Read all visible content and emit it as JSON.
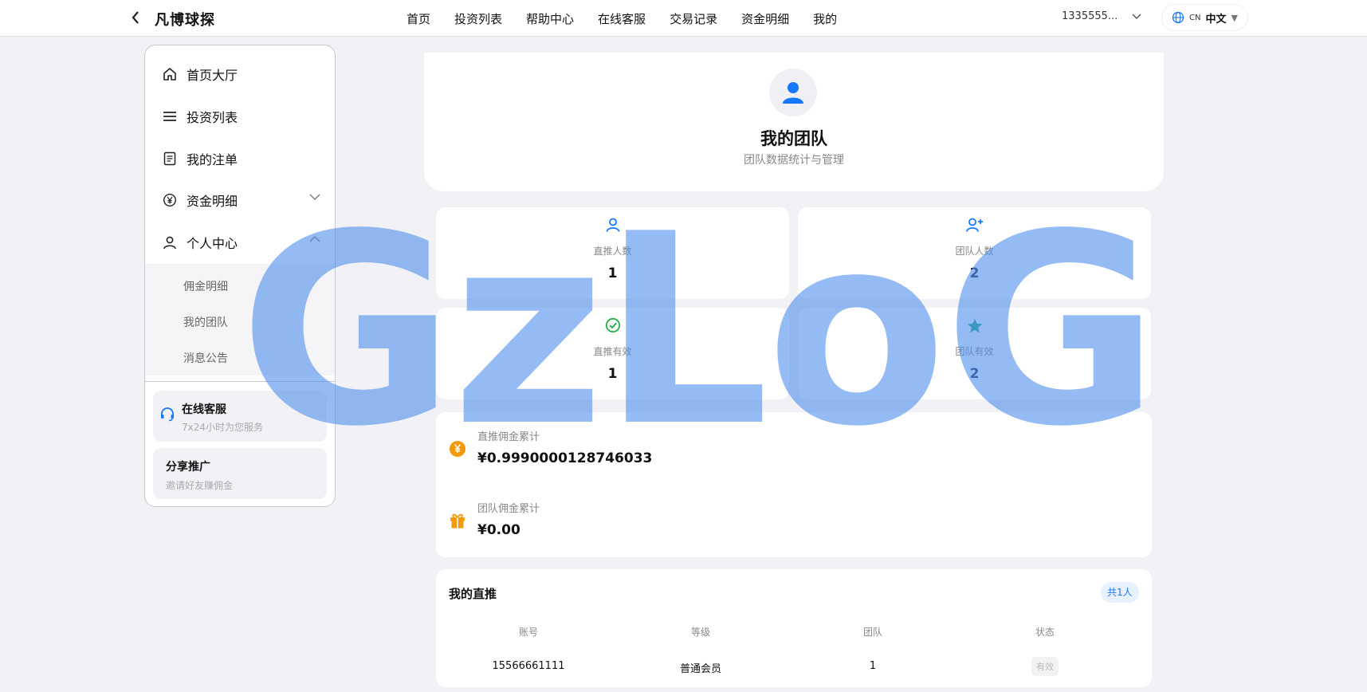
{
  "header": {
    "brand": "凡博球探",
    "nav": [
      "首页",
      "投资列表",
      "帮助中心",
      "在线客服",
      "交易记录",
      "资金明细",
      "我的"
    ],
    "account": "1335555...",
    "lang_code": "CN",
    "lang_label": "中文"
  },
  "sidebar": {
    "items": [
      {
        "label": "首页大厅"
      },
      {
        "label": "投资列表"
      },
      {
        "label": "我的注单"
      },
      {
        "label": "资金明细"
      },
      {
        "label": "个人中心"
      }
    ],
    "sub_items": [
      "佣金明细",
      "我的团队",
      "消息公告"
    ],
    "service": {
      "title": "在线客服",
      "subtitle": "7x24小时为您服务"
    },
    "share": {
      "title": "分享推广",
      "subtitle": "邀请好友赚佣金"
    }
  },
  "profile": {
    "title": "我的团队",
    "subtitle": "团队数据统计与管理"
  },
  "stats": [
    {
      "label": "直推人数",
      "value": "1"
    },
    {
      "label": "团队人数",
      "value": "2"
    },
    {
      "label": "直推有效",
      "value": "1"
    },
    {
      "label": "团队有效",
      "value": "2"
    }
  ],
  "commission": {
    "direct_label": "直推佣金累计",
    "direct_value": "¥0.9990000128746033",
    "team_label": "团队佣金累计",
    "team_value": "¥0.00"
  },
  "direct_table": {
    "title": "我的直推",
    "count": "共1人",
    "columns": [
      "账号",
      "等级",
      "团队",
      "状态"
    ],
    "rows": [
      {
        "account": "15566661111",
        "level": "普通会员",
        "team": "1",
        "status": "有效"
      }
    ]
  },
  "watermark": "GzLoG",
  "colors": {
    "accent": "#1677ff",
    "success": "#22b04a",
    "teal": "#1aa67f",
    "orange": "#f29a0a",
    "watermark": "#4e8eec"
  }
}
